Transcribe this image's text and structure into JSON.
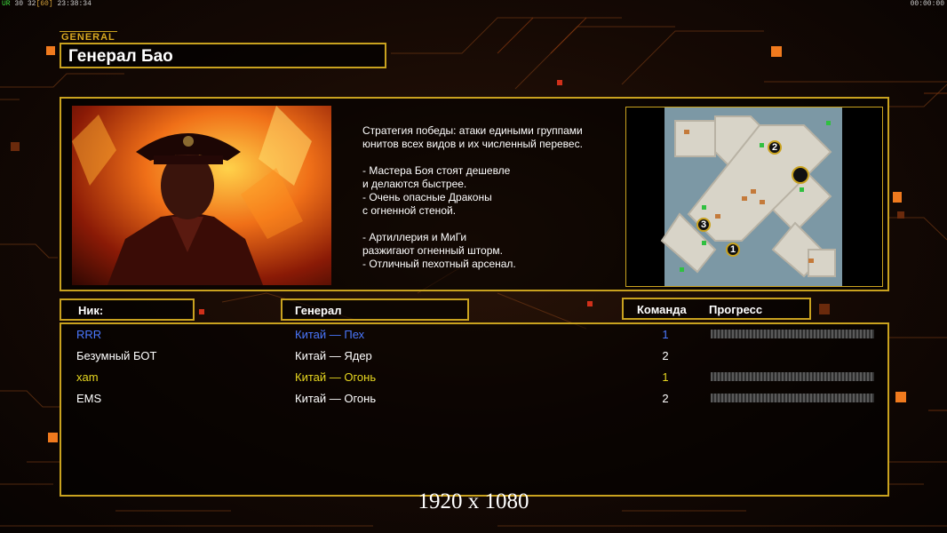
{
  "hud": {
    "fps_prefix": "UR",
    "fps_a": "30",
    "fps_b": "32",
    "fps_max": "[60]",
    "clock": "23:38:34",
    "timer": "00:00:00"
  },
  "general": {
    "tag": "GENERAL",
    "name": "Генерал Бао"
  },
  "description": [
    "Стратегия победы: атаки едиными группами",
    "юнитов всех видов и их численный перевес.",
    "",
    "- Мастера Боя стоят дешевле",
    "и делаются быстрее.",
    "- Очень опасные Драконы",
    "с огненной стеной.",
    "",
    "- Артиллерия и МиГи",
    "разжигают огненный шторм.",
    "- Отличный пехотный арсенал."
  ],
  "map": {
    "start_positions": [
      "1",
      "2",
      "3"
    ]
  },
  "columns": {
    "nick": "Ник:",
    "general": "Генерал",
    "team": "Команда",
    "progress": "Прогресс"
  },
  "players": [
    {
      "nick": "RRR",
      "general": "Китай — Пех",
      "team": "1",
      "color": "#4a78ff",
      "progress_bar": true
    },
    {
      "nick": "Безумный БОТ",
      "general": "Китай — Ядер",
      "team": "2",
      "color": "#ffffff",
      "progress_bar": false
    },
    {
      "nick": "xam",
      "general": "Китай — Огонь",
      "team": "1",
      "color": "#e8d820",
      "progress_bar": true
    },
    {
      "nick": "EMS",
      "general": "Китай — Огонь",
      "team": "2",
      "color": "#ffffff",
      "progress_bar": true
    }
  ],
  "resolution_label": "1920 x 1080",
  "colors": {
    "accent": "#c9a21f",
    "highlight": "#f07a1e"
  }
}
